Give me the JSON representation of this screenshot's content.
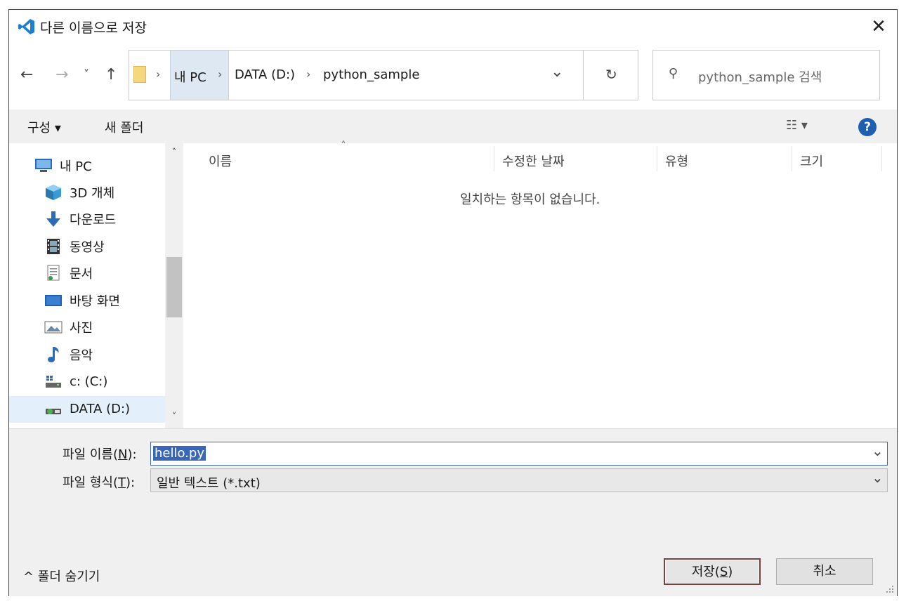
{
  "window": {
    "title": "다른 이름으로 저장",
    "close_glyph": "✕"
  },
  "nav": {
    "back_glyph": "←",
    "forward_glyph": "→",
    "recent_glyph": "˅",
    "up_glyph": "↑",
    "breadcrumbs": [
      "내 PC",
      "DATA (D:)",
      "python_sample"
    ],
    "crumb_sep": "›",
    "dropdown_glyph": "⌄",
    "refresh_glyph": "↻"
  },
  "search": {
    "placeholder": "python_sample 검색",
    "icon_glyph": "⚲"
  },
  "toolbar": {
    "organize_label": "구성 ▾",
    "new_folder_label": "새 폴더",
    "view_glyph": "☷ ▾",
    "help_glyph": "?"
  },
  "sidebar": {
    "items": [
      {
        "label": "내 PC",
        "icon": "computer-icon"
      },
      {
        "label": "3D 개체",
        "icon": "cube-icon"
      },
      {
        "label": "다운로드",
        "icon": "download-icon"
      },
      {
        "label": "동영상",
        "icon": "film-icon"
      },
      {
        "label": "문서",
        "icon": "document-icon"
      },
      {
        "label": "바탕 화면",
        "icon": "desktop-icon"
      },
      {
        "label": "사진",
        "icon": "picture-icon"
      },
      {
        "label": "음악",
        "icon": "music-icon"
      },
      {
        "label": "c: (C:)",
        "icon": "drive-icon"
      },
      {
        "label": "DATA (D:)",
        "icon": "drive-icon"
      }
    ],
    "selected": "DATA (D:)",
    "scroll_up_glyph": "˄",
    "scroll_down_glyph": "˅"
  },
  "filelist": {
    "columns": [
      "이름",
      "수정한 날짜",
      "유형",
      "크기"
    ],
    "sort_glyph": "˄",
    "empty_message": "일치하는 항목이 없습니다."
  },
  "form": {
    "filename_label_pre": "파일 이름(",
    "filename_label_key": "N",
    "filename_label_post": "):",
    "filename_value": "hello.py",
    "filetype_label_pre": "파일 형식(",
    "filetype_label_key": "T",
    "filetype_label_post": "):",
    "filetype_value": "일반 텍스트 (*.txt)",
    "dropdown_glyph": "⌄"
  },
  "footer": {
    "hide_folders_label": "^ 폴더 숨기기",
    "save_pre": "저장(",
    "save_key": "S",
    "save_post": ")",
    "cancel_label": "취소"
  },
  "colors": {
    "accent": "#1f5fb0",
    "selection": "#3a66b8",
    "crumb_highlight": "#dde8f3"
  }
}
